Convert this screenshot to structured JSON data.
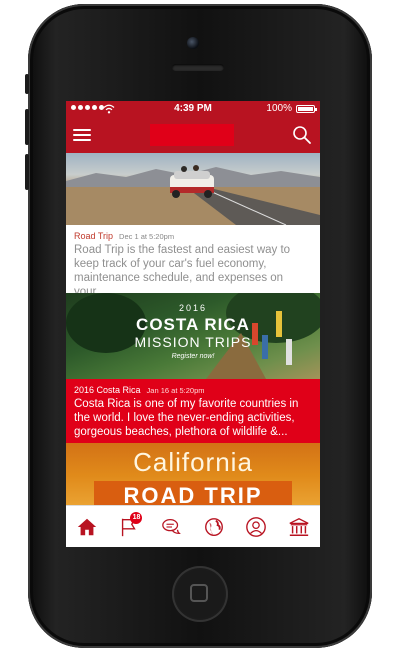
{
  "status_bar": {
    "signal_bars": 5,
    "time": "4:39 PM",
    "battery_pct": "100%"
  },
  "nav": {
    "title": "",
    "menu_icon": "hamburger-icon",
    "search_icon": "search-icon"
  },
  "feed": [
    {
      "category": "Road Trip",
      "date": "Dec 1 at 5:20pm",
      "excerpt": "Road Trip is the fastest and easiest way to keep track of your car's fuel economy, maintenance schedule, and expenses on your..."
    },
    {
      "category": "2016 Costa Rica",
      "date": "Jan 16 at 5:20pm",
      "excerpt": "Costa Rica is one of my favorite countries in the world. I love the never-ending activities, gorgeous beaches, plethora of wildlife &...",
      "image_text": {
        "year": "2016",
        "title": "COSTA RICA",
        "subtitle": "MISSION TRIPS",
        "cta": "Register now!"
      }
    },
    {
      "image_text": {
        "line1": "California",
        "line2": "ROAD TRIP"
      }
    }
  ],
  "tabs": [
    {
      "icon": "home-icon",
      "active": true
    },
    {
      "icon": "flag-icon",
      "badge": "18"
    },
    {
      "icon": "chat-bubbles-icon"
    },
    {
      "icon": "globe-icon"
    },
    {
      "icon": "profile-icon"
    },
    {
      "icon": "museum-icon"
    }
  ],
  "colors": {
    "brand_red": "#b81321",
    "accent_red": "#e00018",
    "active_tab": "#b81321"
  }
}
